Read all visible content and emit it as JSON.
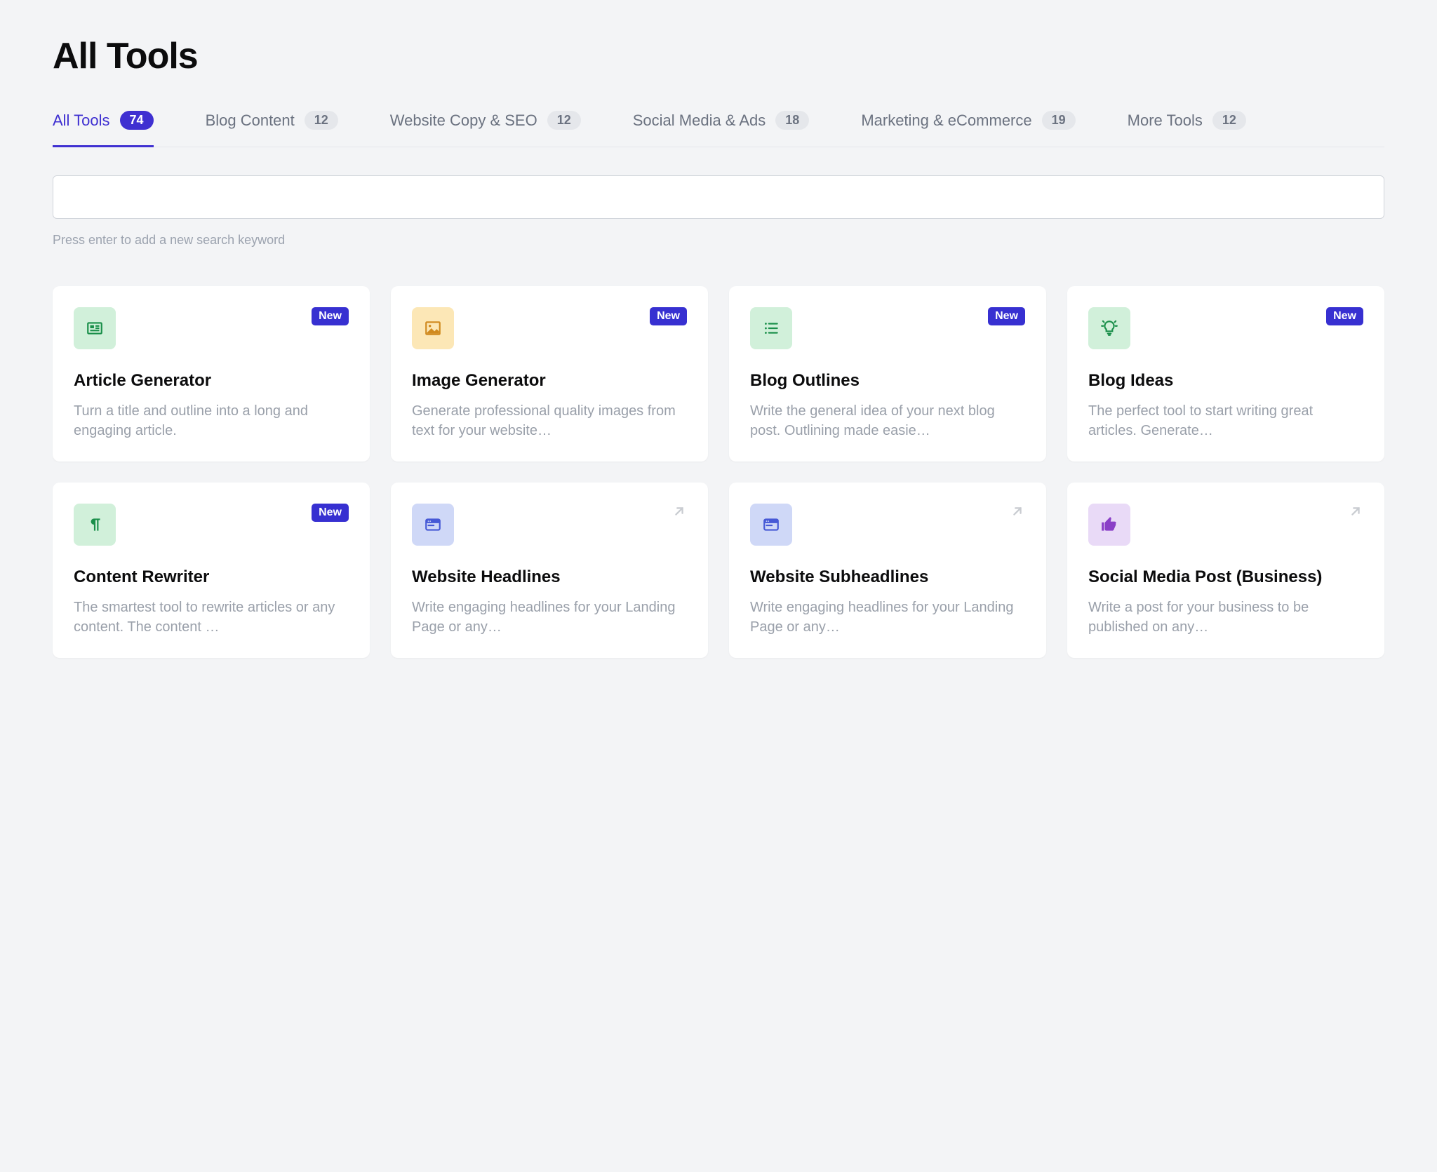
{
  "page": {
    "title": "All Tools"
  },
  "tabs": [
    {
      "label": "All Tools",
      "count": "74",
      "active": true
    },
    {
      "label": "Blog Content",
      "count": "12"
    },
    {
      "label": "Website Copy & SEO",
      "count": "12"
    },
    {
      "label": "Social Media & Ads",
      "count": "18"
    },
    {
      "label": "Marketing & eCommerce",
      "count": "19"
    },
    {
      "label": "More Tools",
      "count": "12"
    }
  ],
  "search": {
    "value": "",
    "hint": "Press enter to add a new search keyword"
  },
  "badges": {
    "new": "New"
  },
  "tools": [
    {
      "title": "Article Generator",
      "desc": "Turn a title and outline into a long and engaging article.",
      "icon": "article-icon",
      "bg": "bg-green",
      "badge": "new"
    },
    {
      "title": "Image Generator",
      "desc": "Generate professional quality images from text for your website…",
      "icon": "image-icon",
      "bg": "bg-yellow",
      "badge": "new"
    },
    {
      "title": "Blog Outlines",
      "desc": "Write the general idea of your next blog post. Outlining made easie…",
      "icon": "list-icon",
      "bg": "bg-green",
      "badge": "new"
    },
    {
      "title": "Blog Ideas",
      "desc": "The perfect tool to start writing great articles. Generate…",
      "icon": "idea-icon",
      "bg": "bg-green",
      "badge": "new"
    },
    {
      "title": "Content Rewriter",
      "desc": "The smartest tool to rewrite articles or any content. The content …",
      "icon": "pilcrow-icon",
      "bg": "bg-green",
      "badge": "new"
    },
    {
      "title": "Website Headlines",
      "desc": "Write engaging headlines for your Landing Page or any…",
      "icon": "window-icon",
      "bg": "bg-blue",
      "badge": "ext"
    },
    {
      "title": "Website Subheadlines",
      "desc": "Write engaging headlines for your Landing Page or any…",
      "icon": "window-icon",
      "bg": "bg-blue",
      "badge": "ext"
    },
    {
      "title": "Social Media Post (Business)",
      "desc": "Write a post for your business to be published on any…",
      "icon": "thumb-icon",
      "bg": "bg-purple",
      "badge": "ext"
    }
  ]
}
